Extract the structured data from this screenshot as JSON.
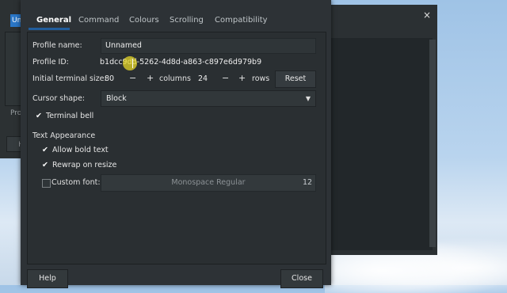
{
  "background_left": {
    "selected_text": "Un",
    "partial_label": "Pro",
    "partial_button": "H"
  },
  "background_right": {
    "close_glyph": "×"
  },
  "tabs": [
    {
      "label": "General",
      "active": true
    },
    {
      "label": "Command",
      "active": false
    },
    {
      "label": "Colours",
      "active": false
    },
    {
      "label": "Scrolling",
      "active": false
    },
    {
      "label": "Compatibility",
      "active": false
    }
  ],
  "general": {
    "profile_name_label": "Profile name:",
    "profile_name_value": "Unnamed",
    "profile_id_label": "Profile ID:",
    "profile_id_value": "b1dcc9dd-5262-4d8d-a863-c897e6d979b9",
    "terminal_size_label": "Initial terminal size:",
    "columns_value": "80",
    "columns_label": "columns",
    "rows_value": "24",
    "rows_label": "rows",
    "minus": "−",
    "plus": "+",
    "reset_label": "Reset",
    "cursor_shape_label": "Cursor shape:",
    "cursor_shape_value": "Block",
    "terminal_bell_label": "Terminal bell",
    "terminal_bell_checked": true,
    "text_appearance_heading": "Text Appearance",
    "allow_bold_label": "Allow bold text",
    "allow_bold_checked": true,
    "rewrap_label": "Rewrap on resize",
    "rewrap_checked": true,
    "custom_font_label": "Custom font:",
    "custom_font_checked": false,
    "font_name": "Monospace Regular",
    "font_size": "12"
  },
  "footer": {
    "help_label": "Help",
    "close_label": "Close"
  },
  "colors": {
    "accent": "#215d9c",
    "dialog_bg": "#2d3236",
    "cursor_highlight": "#e6d728"
  }
}
